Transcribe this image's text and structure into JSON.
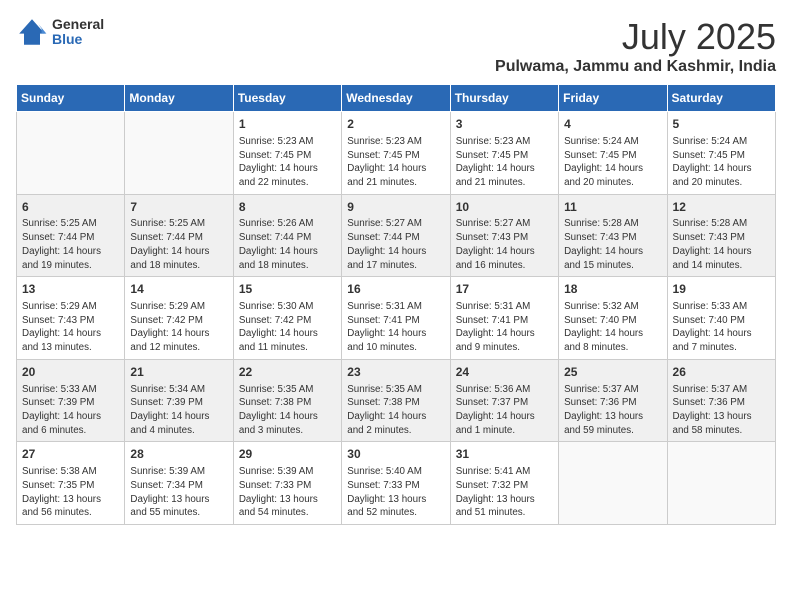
{
  "logo": {
    "general": "General",
    "blue": "Blue"
  },
  "title": "July 2025",
  "subtitle": "Pulwama, Jammu and Kashmir, India",
  "weekdays": [
    "Sunday",
    "Monday",
    "Tuesday",
    "Wednesday",
    "Thursday",
    "Friday",
    "Saturday"
  ],
  "weeks": [
    [
      {
        "day": "",
        "info": ""
      },
      {
        "day": "",
        "info": ""
      },
      {
        "day": "1",
        "info": "Sunrise: 5:23 AM\nSunset: 7:45 PM\nDaylight: 14 hours and 22 minutes."
      },
      {
        "day": "2",
        "info": "Sunrise: 5:23 AM\nSunset: 7:45 PM\nDaylight: 14 hours and 21 minutes."
      },
      {
        "day": "3",
        "info": "Sunrise: 5:23 AM\nSunset: 7:45 PM\nDaylight: 14 hours and 21 minutes."
      },
      {
        "day": "4",
        "info": "Sunrise: 5:24 AM\nSunset: 7:45 PM\nDaylight: 14 hours and 20 minutes."
      },
      {
        "day": "5",
        "info": "Sunrise: 5:24 AM\nSunset: 7:45 PM\nDaylight: 14 hours and 20 minutes."
      }
    ],
    [
      {
        "day": "6",
        "info": "Sunrise: 5:25 AM\nSunset: 7:44 PM\nDaylight: 14 hours and 19 minutes."
      },
      {
        "day": "7",
        "info": "Sunrise: 5:25 AM\nSunset: 7:44 PM\nDaylight: 14 hours and 18 minutes."
      },
      {
        "day": "8",
        "info": "Sunrise: 5:26 AM\nSunset: 7:44 PM\nDaylight: 14 hours and 18 minutes."
      },
      {
        "day": "9",
        "info": "Sunrise: 5:27 AM\nSunset: 7:44 PM\nDaylight: 14 hours and 17 minutes."
      },
      {
        "day": "10",
        "info": "Sunrise: 5:27 AM\nSunset: 7:43 PM\nDaylight: 14 hours and 16 minutes."
      },
      {
        "day": "11",
        "info": "Sunrise: 5:28 AM\nSunset: 7:43 PM\nDaylight: 14 hours and 15 minutes."
      },
      {
        "day": "12",
        "info": "Sunrise: 5:28 AM\nSunset: 7:43 PM\nDaylight: 14 hours and 14 minutes."
      }
    ],
    [
      {
        "day": "13",
        "info": "Sunrise: 5:29 AM\nSunset: 7:43 PM\nDaylight: 14 hours and 13 minutes."
      },
      {
        "day": "14",
        "info": "Sunrise: 5:29 AM\nSunset: 7:42 PM\nDaylight: 14 hours and 12 minutes."
      },
      {
        "day": "15",
        "info": "Sunrise: 5:30 AM\nSunset: 7:42 PM\nDaylight: 14 hours and 11 minutes."
      },
      {
        "day": "16",
        "info": "Sunrise: 5:31 AM\nSunset: 7:41 PM\nDaylight: 14 hours and 10 minutes."
      },
      {
        "day": "17",
        "info": "Sunrise: 5:31 AM\nSunset: 7:41 PM\nDaylight: 14 hours and 9 minutes."
      },
      {
        "day": "18",
        "info": "Sunrise: 5:32 AM\nSunset: 7:40 PM\nDaylight: 14 hours and 8 minutes."
      },
      {
        "day": "19",
        "info": "Sunrise: 5:33 AM\nSunset: 7:40 PM\nDaylight: 14 hours and 7 minutes."
      }
    ],
    [
      {
        "day": "20",
        "info": "Sunrise: 5:33 AM\nSunset: 7:39 PM\nDaylight: 14 hours and 6 minutes."
      },
      {
        "day": "21",
        "info": "Sunrise: 5:34 AM\nSunset: 7:39 PM\nDaylight: 14 hours and 4 minutes."
      },
      {
        "day": "22",
        "info": "Sunrise: 5:35 AM\nSunset: 7:38 PM\nDaylight: 14 hours and 3 minutes."
      },
      {
        "day": "23",
        "info": "Sunrise: 5:35 AM\nSunset: 7:38 PM\nDaylight: 14 hours and 2 minutes."
      },
      {
        "day": "24",
        "info": "Sunrise: 5:36 AM\nSunset: 7:37 PM\nDaylight: 14 hours and 1 minute."
      },
      {
        "day": "25",
        "info": "Sunrise: 5:37 AM\nSunset: 7:36 PM\nDaylight: 13 hours and 59 minutes."
      },
      {
        "day": "26",
        "info": "Sunrise: 5:37 AM\nSunset: 7:36 PM\nDaylight: 13 hours and 58 minutes."
      }
    ],
    [
      {
        "day": "27",
        "info": "Sunrise: 5:38 AM\nSunset: 7:35 PM\nDaylight: 13 hours and 56 minutes."
      },
      {
        "day": "28",
        "info": "Sunrise: 5:39 AM\nSunset: 7:34 PM\nDaylight: 13 hours and 55 minutes."
      },
      {
        "day": "29",
        "info": "Sunrise: 5:39 AM\nSunset: 7:33 PM\nDaylight: 13 hours and 54 minutes."
      },
      {
        "day": "30",
        "info": "Sunrise: 5:40 AM\nSunset: 7:33 PM\nDaylight: 13 hours and 52 minutes."
      },
      {
        "day": "31",
        "info": "Sunrise: 5:41 AM\nSunset: 7:32 PM\nDaylight: 13 hours and 51 minutes."
      },
      {
        "day": "",
        "info": ""
      },
      {
        "day": "",
        "info": ""
      }
    ]
  ]
}
